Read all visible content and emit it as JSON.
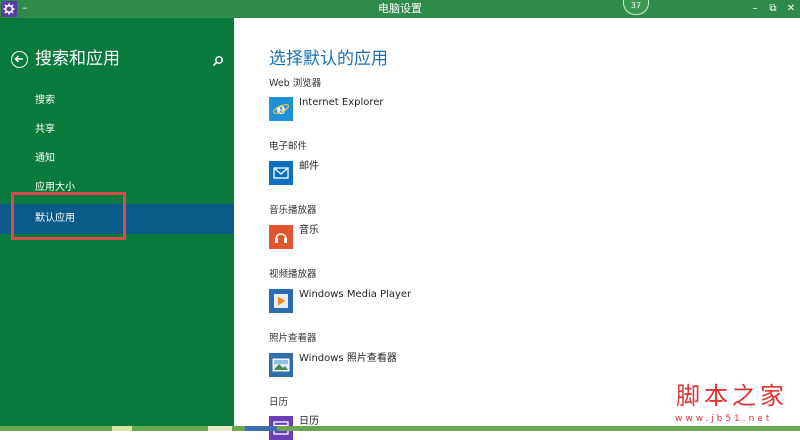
{
  "window": {
    "title": "电脑设置",
    "system_menu": "–",
    "badge": "37",
    "minimize_glyph": "–",
    "restore_glyph": "⧉",
    "close_glyph": "✕"
  },
  "left_pane": {
    "title": "搜索和应用",
    "nav": [
      {
        "label": "搜索",
        "selected": false
      },
      {
        "label": "共享",
        "selected": false
      },
      {
        "label": "通知",
        "selected": false
      },
      {
        "label": "应用大小",
        "selected": false
      },
      {
        "label": "默认应用",
        "selected": true
      }
    ]
  },
  "right_pane": {
    "title": "选择默认的应用",
    "sections": [
      {
        "label": "Web 浏览器",
        "app": "Internet Explorer",
        "icon": "internet-explorer-icon",
        "tile_color": "#1f8fd6"
      },
      {
        "label": "电子邮件",
        "app": "邮件",
        "icon": "mail-icon",
        "tile_color": "#0a6fbf"
      },
      {
        "label": "音乐播放器",
        "app": "音乐",
        "icon": "music-icon",
        "tile_color": "#e2552c"
      },
      {
        "label": "视频播放器",
        "app": "Windows Media Player",
        "icon": "media-player-icon",
        "tile_color": "#2a6db0"
      },
      {
        "label": "照片查看器",
        "app": "Windows 照片查看器",
        "icon": "photo-viewer-icon",
        "tile_color": "#2f6ea8"
      },
      {
        "label": "日历",
        "app": "日历",
        "icon": "calendar-icon",
        "tile_color": "#6b3fb5"
      }
    ]
  },
  "watermark": {
    "text": "脚本之家",
    "url": "www.jb51.net"
  },
  "colors": {
    "left_bg": "#0a7a3c",
    "selected_bg": "#0a5a8a",
    "accent_title": "#1b6fb3",
    "annotation_box": "#d94a4a"
  }
}
